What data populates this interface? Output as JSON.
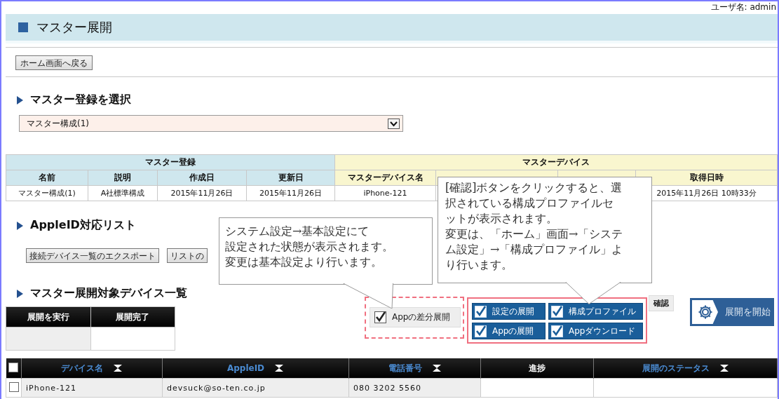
{
  "header": {
    "user_label": "ユーザ名: admin"
  },
  "page_title": "マスター展開",
  "back_button": "ホーム画面へ戻る",
  "master_select": {
    "heading": "マスター登録を選択",
    "value": "マスター構成(1)"
  },
  "master_table": {
    "groups": [
      {
        "label": "マスター登録",
        "kind": "registration",
        "columns": [
          {
            "label": "名前"
          },
          {
            "label": "説明"
          },
          {
            "label": "作成日"
          },
          {
            "label": "更新日"
          }
        ]
      },
      {
        "label": "マスターデバイス",
        "kind": "device",
        "columns": [
          {
            "label": "マスターデバイス名"
          },
          {},
          {},
          {
            "label": "取得日時"
          }
        ]
      }
    ],
    "rows": [
      {
        "cells": [
          "マスター構成(1)",
          "A社標準構成",
          "2015年11月26日",
          "2015年11月26日",
          "iPhone-121",
          null,
          null,
          "2015年11月26日 10時33分"
        ]
      }
    ]
  },
  "appleid_section": {
    "heading": "AppleID対応リスト",
    "buttons": [
      "接続デバイス一覧のエクスポート",
      "リストの"
    ]
  },
  "deploy_section": {
    "heading": "マスター展開対象デバイス一覧",
    "status_table": {
      "columns": [
        "展開を実行",
        "展開完了"
      ]
    },
    "diff_option": {
      "label": "Appの差分展開",
      "checked": true
    },
    "options": [
      {
        "label": "設定の展開",
        "checked": true
      },
      {
        "label": "構成プロファイル",
        "checked": true
      },
      {
        "label": "Appの展開",
        "checked": true
      },
      {
        "label": "Appダウンロード",
        "checked": true
      }
    ],
    "confirm_button": "確認",
    "start_button": "展開を開始"
  },
  "device_table": {
    "select_all": false,
    "columns": [
      {
        "label": "デバイス名",
        "sortable": true
      },
      {
        "label": "AppleID",
        "sortable": true
      },
      {
        "label": "電話番号",
        "sortable": true
      },
      {
        "label": "進捗",
        "sortable": false
      },
      {
        "label": "展開のステータス",
        "sortable": true
      }
    ],
    "rows": [
      {
        "selected": false,
        "cells": [
          "iPhone-121",
          "devsuck@so-ten.co.jp",
          "080 3202 5560",
          "",
          ""
        ]
      }
    ]
  },
  "callouts": [
    {
      "lines": [
        "システム設定→基本設定にて",
        "設定された状態が表示されます。",
        "変更は基本設定より行います。"
      ]
    },
    {
      "lines": [
        "[確認]ボタンをクリックすると、選",
        "択されている構成プロファイルセ",
        "ットが表示されます。",
        "変更は、「ホーム」画面→「システ",
        "ム設定」→「構成プロファイル」よ",
        "り行います。"
      ]
    }
  ]
}
